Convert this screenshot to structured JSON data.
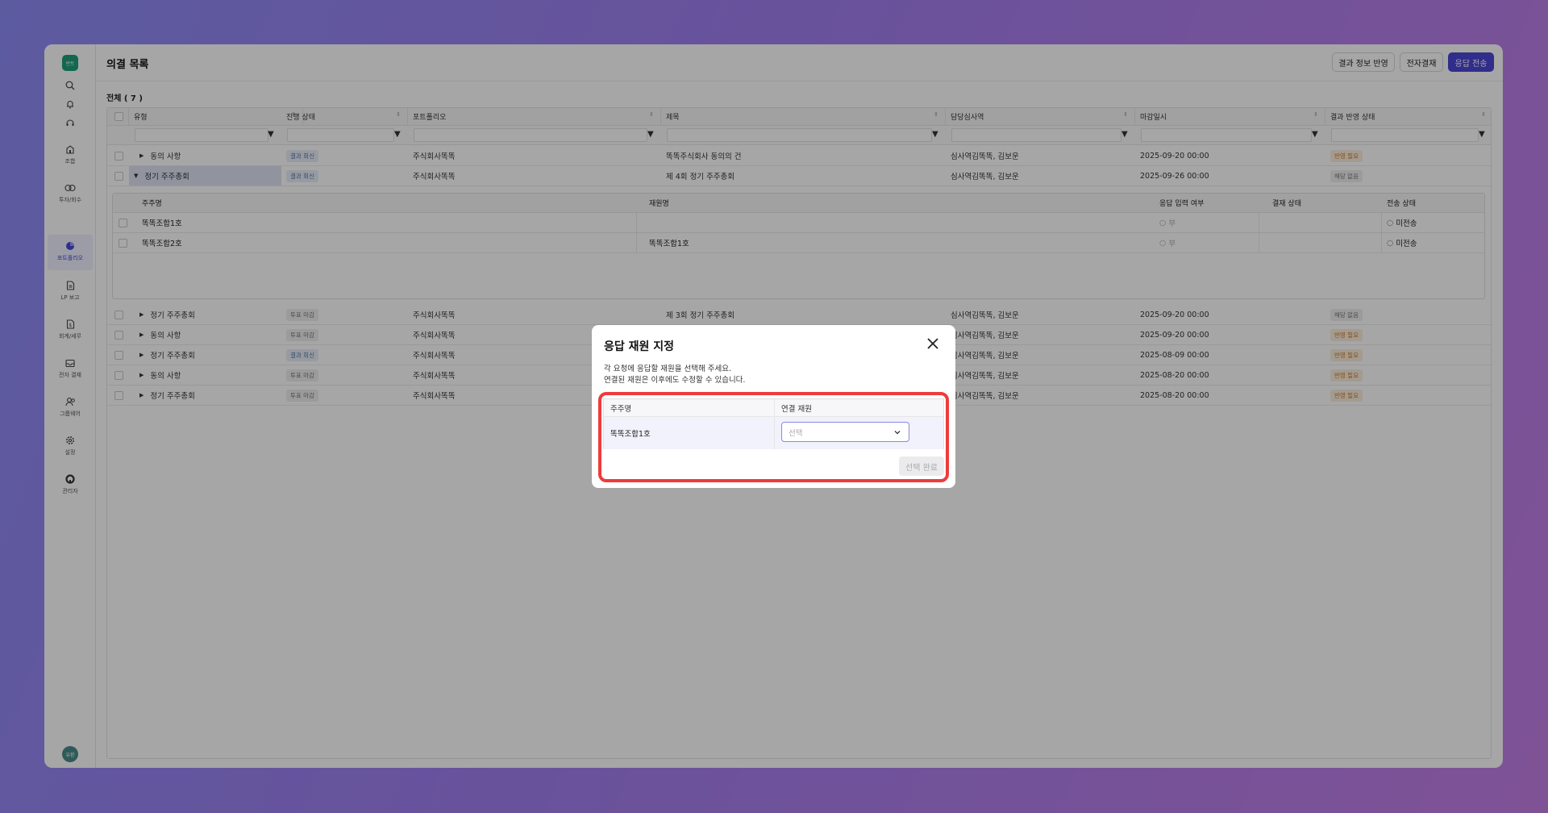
{
  "logo": "번트",
  "sidebar": {
    "items": [
      {
        "label": "",
        "icon": "search-icon"
      },
      {
        "label": "",
        "icon": "bell-icon"
      },
      {
        "label": "",
        "icon": "headset-icon"
      },
      {
        "label": "조합",
        "icon": "building-icon"
      },
      {
        "label": "투자/회수",
        "icon": "coins-icon"
      },
      {
        "label": "포트폴리오",
        "icon": "pie-chart-icon"
      },
      {
        "label": "LP 보고",
        "icon": "document-icon"
      },
      {
        "label": "회계/세무",
        "icon": "calculator-icon"
      },
      {
        "label": "전자 결재",
        "icon": "inbox-icon"
      },
      {
        "label": "그룹웨어",
        "icon": "users-icon"
      },
      {
        "label": "설정",
        "icon": "gear-icon"
      },
      {
        "label": "관리자",
        "icon": "admin-icon"
      }
    ],
    "avatar": "유환"
  },
  "header": {
    "title": "의결 목록",
    "btn_result": "결과 정보 반영",
    "btn_approval": "전자결재",
    "btn_send": "응답 전송"
  },
  "count_label": "전체 ( 7 )",
  "table": {
    "columns": [
      "유형",
      "진행 상태",
      "포트폴리오",
      "제목",
      "담당심사역",
      "마감일시",
      "결과 반영 상태"
    ],
    "rows_top": [
      {
        "type": "동의 사항",
        "status": "결과 회신",
        "portfolio": "주식회사똑똑",
        "title": "똑똑주식회사 동의의 건",
        "manager": "심사역김똑똑, 김보운",
        "deadline": "2025-09-20 00:00",
        "result": "반영 필요"
      },
      {
        "type": "정기 주주총회",
        "status": "결과 회신",
        "portfolio": "주식회사똑똑",
        "title": "제 4회 정기 주주총회",
        "manager": "심사역김똑똑, 김보운",
        "deadline": "2025-09-26 00:00",
        "result": "해당 없음"
      }
    ],
    "rows_bottom": [
      {
        "type": "정기 주주총회",
        "status": "투표 마감",
        "portfolio": "주식회사똑똑",
        "title": "제 3회 정기 주주총회",
        "manager": "심사역김똑똑, 김보운",
        "deadline": "2025-09-20 00:00",
        "result": "해당 없음"
      },
      {
        "type": "동의 사항",
        "status": "투표 마감",
        "portfolio": "주식회사똑똑",
        "title": "",
        "manager": "심사역김똑똑, 김보운",
        "deadline": "2025-09-20 00:00",
        "result": "반영 필요"
      },
      {
        "type": "정기 주주총회",
        "status": "결과 회신",
        "portfolio": "주식회사똑똑",
        "title": "",
        "manager": "심사역김똑똑, 김보운",
        "deadline": "2025-08-09 00:00",
        "result": "반영 필요"
      },
      {
        "type": "동의 사항",
        "status": "투표 마감",
        "portfolio": "주식회사똑똑",
        "title": "",
        "manager": "심사역김똑똑, 김보운",
        "deadline": "2025-08-20 00:00",
        "result": "반영 필요"
      },
      {
        "type": "정기 주주총회",
        "status": "투표 마감",
        "portfolio": "주식회사똑똑",
        "title": "",
        "manager": "심사역김똑똑, 김보운",
        "deadline": "2025-08-20 00:00",
        "result": "반영 필요"
      }
    ],
    "sub_columns": [
      "주주명",
      "재원명",
      "응답 입력 여부",
      "결재 상태",
      "전송 상태"
    ],
    "sub_rows": [
      {
        "holder": "똑똑조합1호",
        "fund": "",
        "input": "부",
        "approval": "",
        "send": "미전송"
      },
      {
        "holder": "똑똑조합2호",
        "fund": "똑똑조합1호",
        "input": "부",
        "approval": "",
        "send": "미전송"
      }
    ]
  },
  "modal": {
    "title": "응답 재원 지정",
    "desc1": "각 요청에 응답할 재원을 선택해 주세요.",
    "desc2": "연결된 재원은 이후에도 수정할 수 있습니다.",
    "col_holder": "주주명",
    "col_fund": "연결 재원",
    "row_holder": "똑똑조합1호",
    "select_placeholder": "선택",
    "confirm": "선택 완료"
  }
}
